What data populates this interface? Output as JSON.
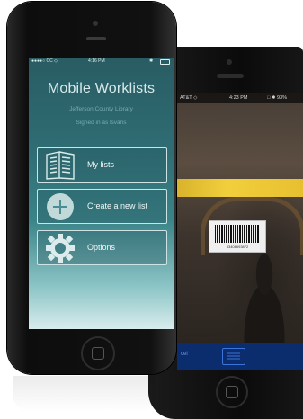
{
  "front_phone": {
    "status": {
      "carrier": "●●●●○ CC ◇",
      "time": "4:16 PM",
      "bluetooth": "✱"
    },
    "app_title": "Mobile Worklists",
    "library": "Jefferson County Library",
    "signed_in": "Signed in as lsvans",
    "menu": [
      {
        "label": "My lists",
        "icon": "book-pages-icon"
      },
      {
        "label": "Create a new list",
        "icon": "plus-circle-icon"
      },
      {
        "label": "Options",
        "icon": "gear-icon"
      }
    ]
  },
  "back_phone": {
    "status": {
      "carrier": "AT&T ◇",
      "time": "4:23 PM",
      "battery": "□ ✱ 93%"
    },
    "barcode_number": "33408693872",
    "toolbar_left": "cel"
  },
  "colors": {
    "screen_top": "#295c63",
    "screen_bottom": "#d8ecec",
    "toolbar": "#0b2d6e",
    "barcode_band": "#f1cf3c"
  }
}
